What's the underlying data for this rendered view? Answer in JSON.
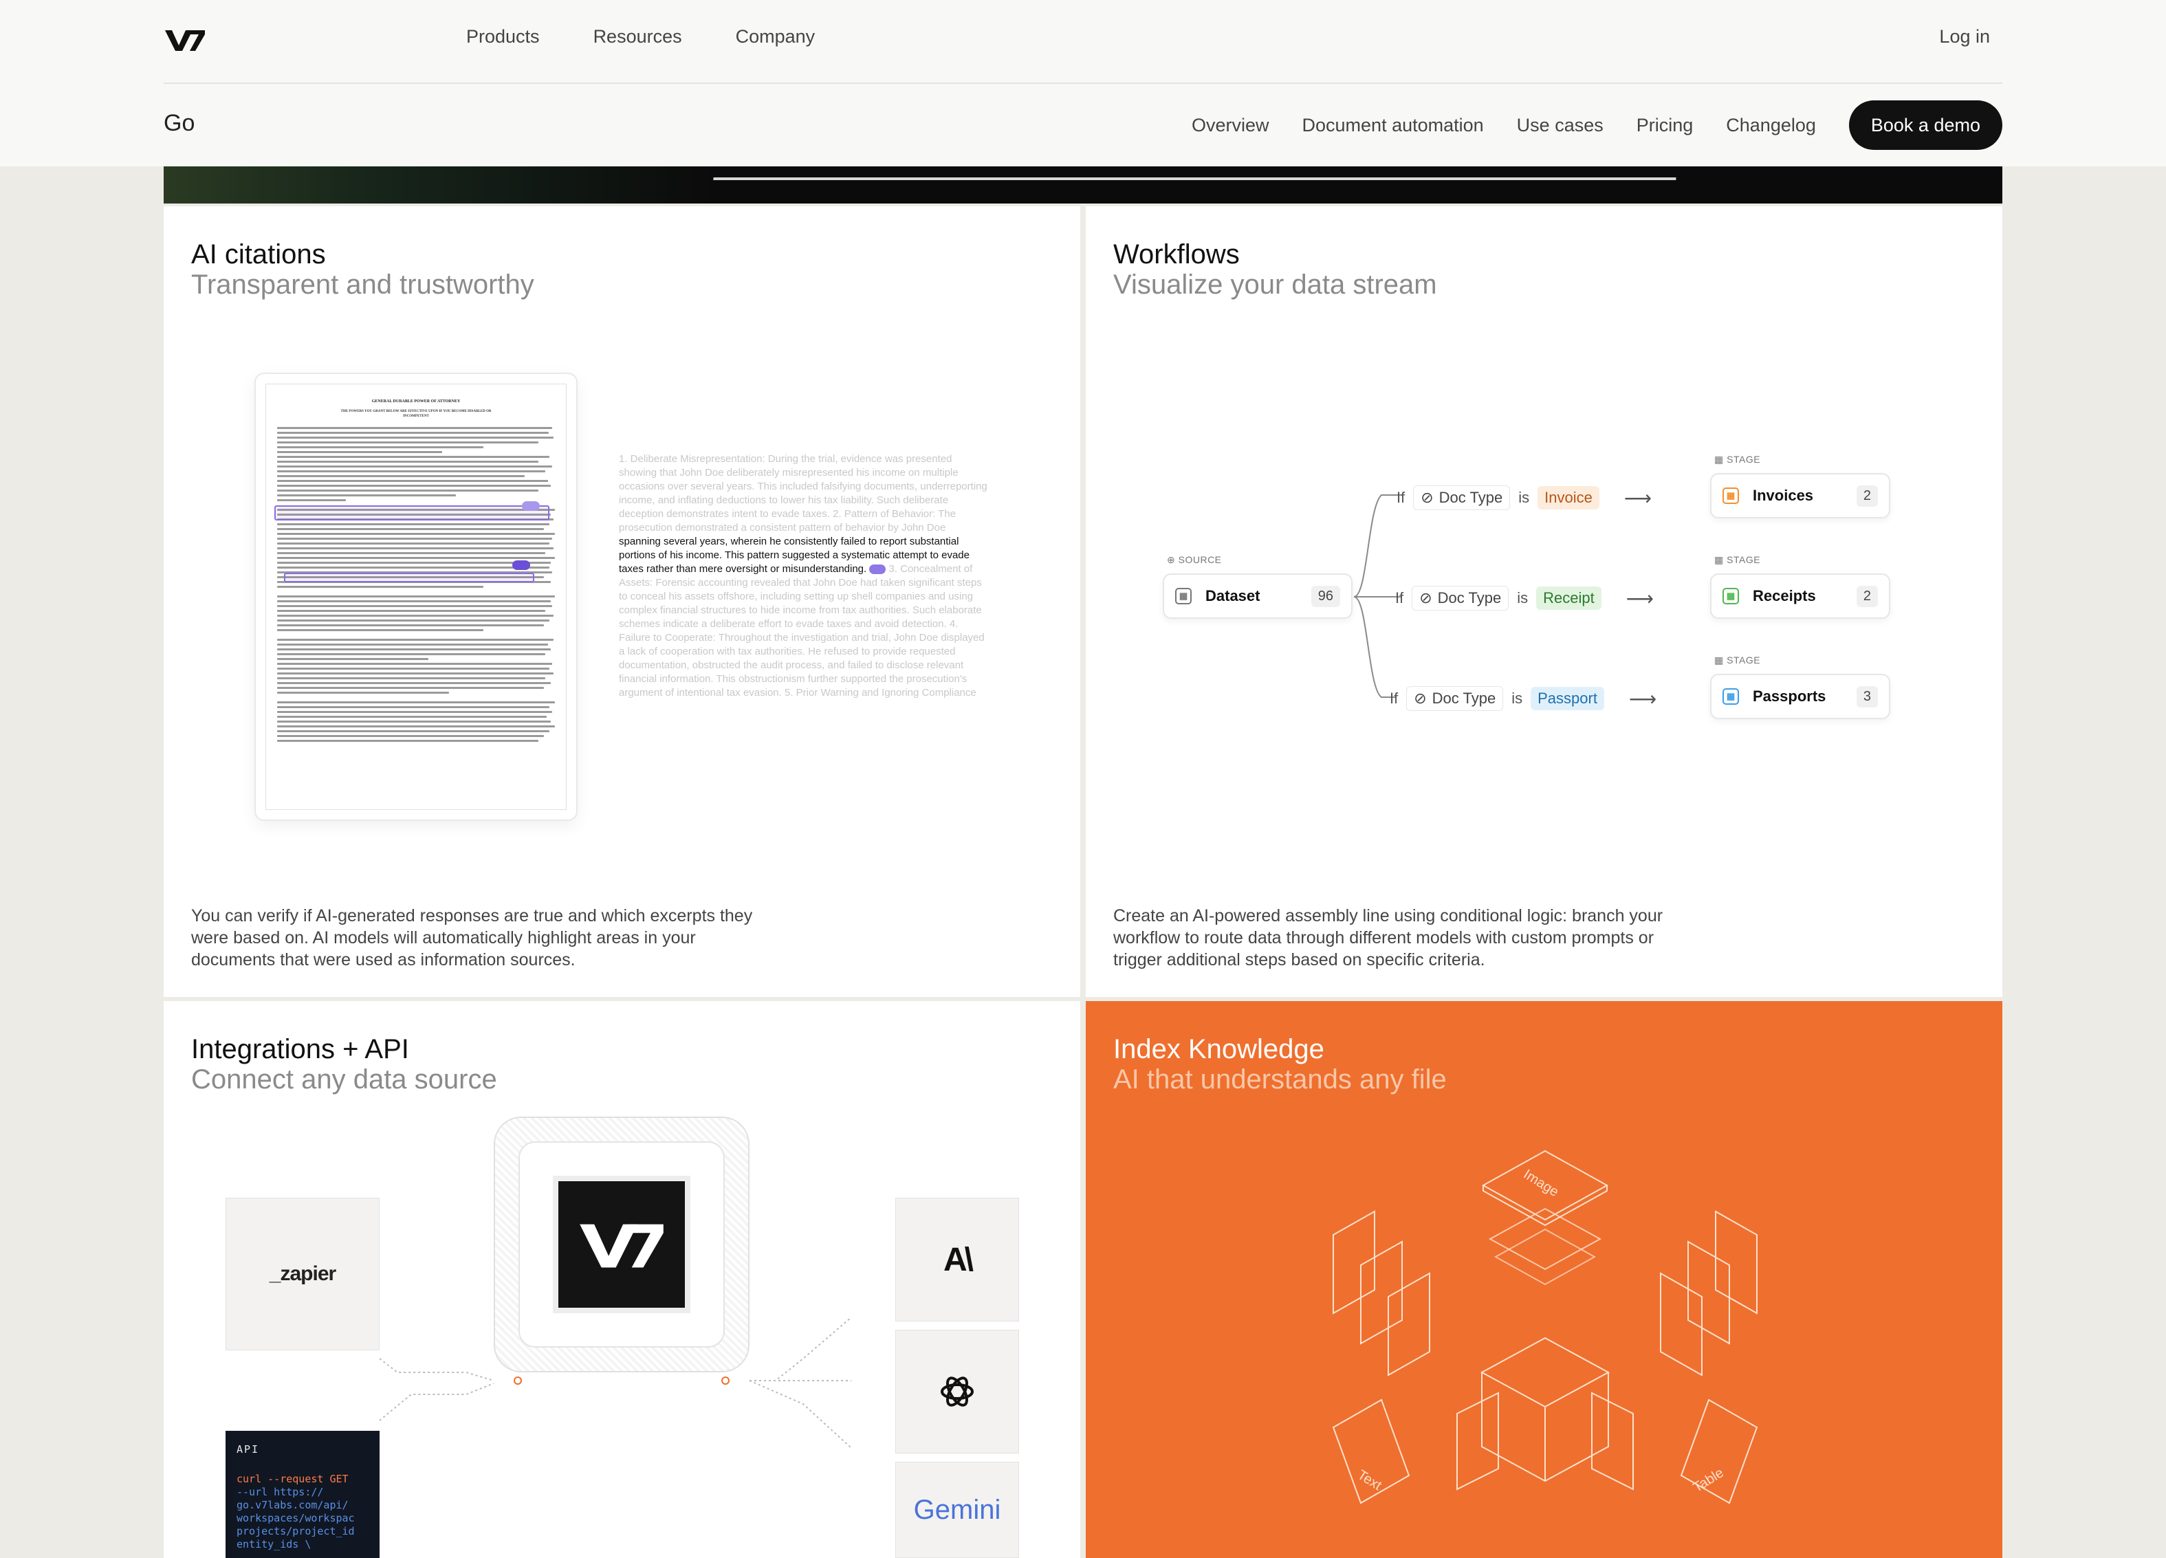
{
  "nav": {
    "logo": "V7",
    "top_links": [
      "Products",
      "Resources",
      "Company"
    ],
    "login": "Log in",
    "product": "Go",
    "sub_links": [
      "Overview",
      "Document automation",
      "Use cases",
      "Pricing",
      "Changelog"
    ],
    "cta": "Book a demo"
  },
  "cards": {
    "citations": {
      "title": "AI citations",
      "subtitle": "Transparent and trustworthy",
      "description": "You can verify if AI-generated responses are true and which excerpts they were based on. AI models will automatically highlight areas in your documents that were used as information sources.",
      "doc_title": "GENERAL DURABLE POWER OF ATTORNEY",
      "doc_subtitle": "THE POWERS YOU GRANT BELOW ARE EFFECTIVE UPON IF YOU BECOME DISABLED OR INCOMPETENT",
      "excerpt": {
        "before": "1. Deliberate Misrepresentation: During the trial, evidence was presented showing that John Doe deliberately misrepresented his income on multiple occasions over several years. This included falsifying documents, underreporting income, and inflating deductions to lower his tax liability. Such deliberate deception demonstrates intent to evade taxes. 2. Pattern of Behavior: The prosecution demonstrated a consistent pattern of behavior by John Doe",
        "highlight": "spanning several years, wherein he consistently failed to report substantial portions of his income. This pattern suggested a systematic attempt to evade taxes rather than mere oversight or misunderstanding.",
        "after": "3. Concealment of Assets: Forensic accounting revealed that John Doe had taken significant steps to conceal his assets offshore, including setting up shell companies and using complex financial structures to hide income from tax authorities. Such elaborate schemes indicate a deliberate effort to evade taxes and avoid detection. 4. Failure to Cooperate: Throughout the investigation and trial, John Doe displayed a lack of cooperation with tax authorities. He refused to provide requested documentation, obstructed the audit process, and failed to disclose relevant financial information. This obstructionism further supported the prosecution's argument of intentional tax evasion. 5. Prior Warning and Ignoring Compliance"
      }
    },
    "workflows": {
      "title": "Workflows",
      "subtitle": "Visualize your data stream",
      "description": "Create an AI-powered assembly line using conditional logic: branch your workflow to route data through different models with custom prompts or trigger additional steps based on specific criteria.",
      "source_label": "SOURCE",
      "source": {
        "name": "Dataset",
        "count": "96"
      },
      "stage_label": "STAGE",
      "if_word": "If",
      "field": "Doc Type",
      "is_word": "is",
      "branches": [
        {
          "value": "Invoice",
          "stage": "Invoices",
          "count": "2",
          "color": "#f2902e",
          "tag_bg": "#fdecdc",
          "tag_fg": "#b5561a"
        },
        {
          "value": "Receipt",
          "stage": "Receipts",
          "count": "2",
          "color": "#4fb84f",
          "tag_bg": "#e2f4e0",
          "tag_fg": "#2b7a2b"
        },
        {
          "value": "Passport",
          "stage": "Passports",
          "count": "3",
          "color": "#3b9ee8",
          "tag_bg": "#e0f0fb",
          "tag_fg": "#1f6fab"
        }
      ]
    },
    "integrations": {
      "title": "Integrations + API",
      "subtitle": "Connect any data source",
      "zapier": "_zapier",
      "api_label": "API",
      "api_code": [
        "curl --request GET",
        "    --url https://",
        "go.v7labs.com/api/",
        "workspaces/workspac",
        "projects/project_id",
        "entity_ids \\"
      ],
      "hub_logo": "V7",
      "providers": [
        "A\\",
        "openai-icon",
        "Gemini"
      ]
    },
    "index": {
      "title": "Index Knowledge",
      "subtitle": "AI that understands any file",
      "labels": [
        "Image",
        "Text",
        "Table"
      ]
    }
  }
}
